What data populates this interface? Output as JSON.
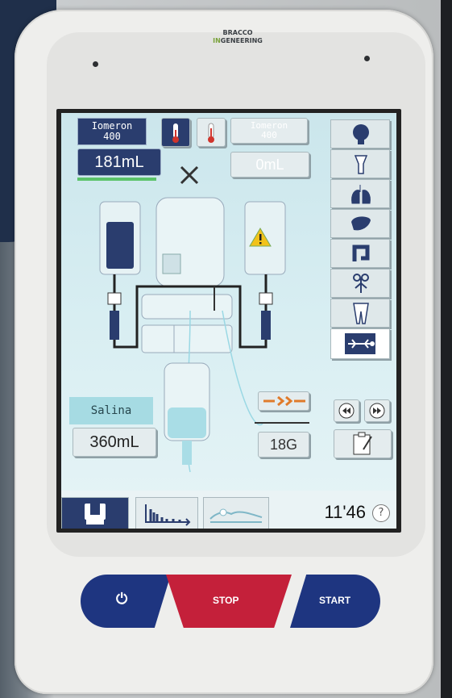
{
  "brand": {
    "line1": "BRACCO",
    "line2_a": "IN",
    "line2_b": "GENEERING"
  },
  "contrast": {
    "name": "Iomeron\n400",
    "volume": "181mL"
  },
  "contrast2": {
    "name": "Iomeron\n400",
    "volume": "0mL"
  },
  "saline": {
    "name": "Salina",
    "volume": "360mL"
  },
  "needle": {
    "gauge": "18G"
  },
  "timer": {
    "value": "11'46",
    "help_label": "?"
  },
  "controls": {
    "power_label": "⏻",
    "stop_label": "STOP",
    "start_label": "START"
  },
  "colors": {
    "accent": "#2a3d6e",
    "stop": "#c4203a",
    "start": "#1e3580",
    "screen": "#d3ecf1",
    "warning": "#f2c21a",
    "needle_arrow": "#e07a2a"
  },
  "side_icons": [
    "head-icon",
    "neck-icon",
    "lungs-icon",
    "liver-icon",
    "colon-icon",
    "abdomen-icon",
    "legs-icon",
    "full-body-icon"
  ],
  "bottom_tabs": [
    "injector-tab",
    "protocol-graph-tab",
    "patient-tab"
  ]
}
